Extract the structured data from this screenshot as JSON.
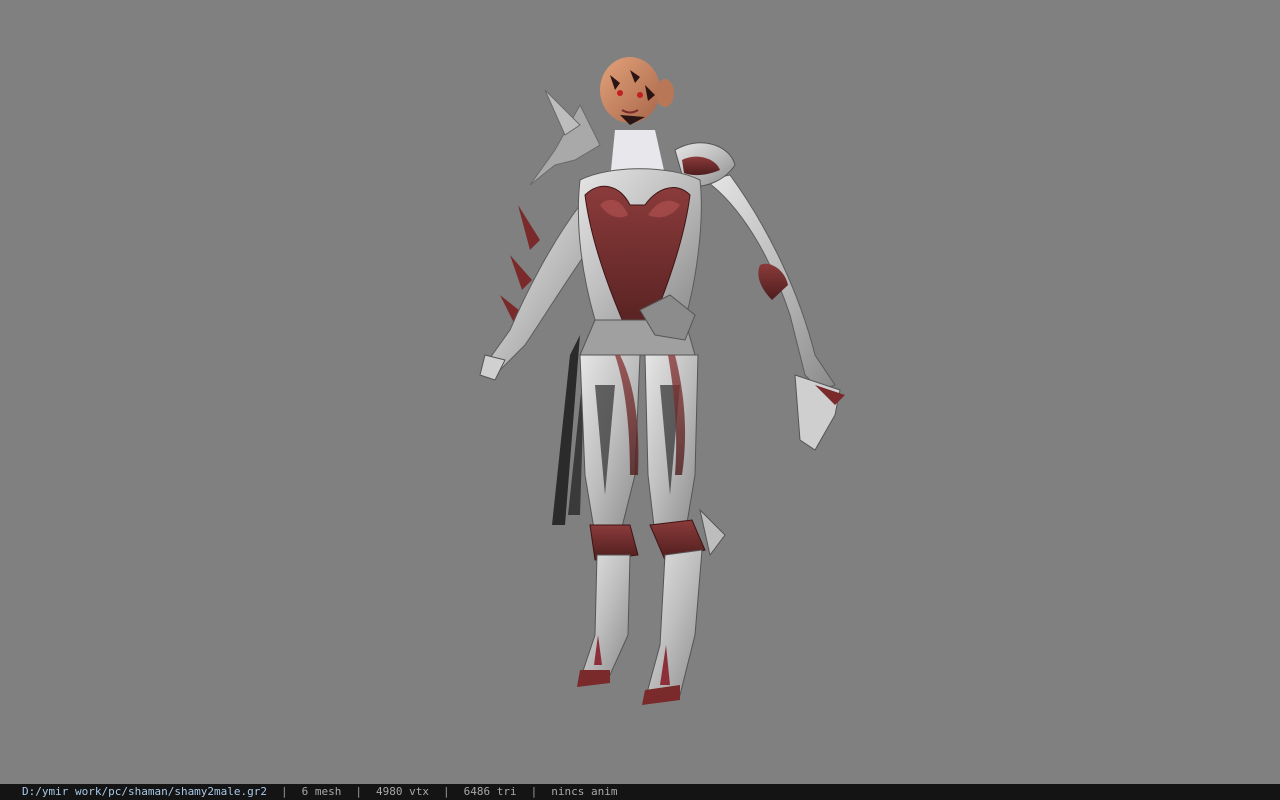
{
  "viewer": {
    "background_color": "#808080",
    "model_icon": "character-model-icon"
  },
  "status": {
    "path": "D:/ymir work/pc/shaman/shamy2male.gr2",
    "separator": "|",
    "mesh": "6 mesh",
    "vtx": "4980 vtx",
    "tri": "6486 tri",
    "anim": "nincs anim"
  }
}
